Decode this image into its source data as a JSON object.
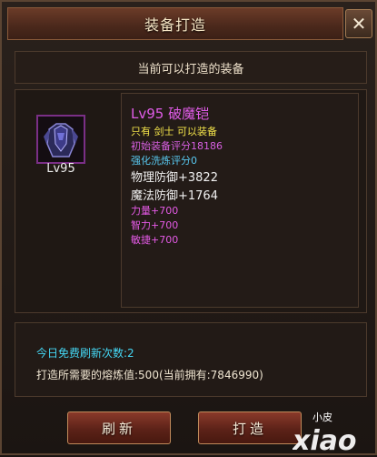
{
  "window": {
    "title": "装备打造",
    "close_icon": "close-x-icon",
    "subtitle": "当前可以打造的装备"
  },
  "item": {
    "icon": "armor-icon",
    "level_label": "Lv95",
    "name": "Lv95 破魔铠",
    "restriction": "只有 剑士 可以装备",
    "base_score": "初始装备评分18186",
    "refine_score": "强化洗炼评分0",
    "stats": [
      "物理防御+3822",
      "魔法防御+1764"
    ],
    "bonus_stats": [
      "力量+700",
      "智力+700",
      "敏捷+700"
    ]
  },
  "info": {
    "free_refresh": "今日免费刷新次数:2",
    "cost": "打造所需要的熔炼值:500(当前拥有:7846990)"
  },
  "buttons": {
    "refresh": "刷新",
    "forge": "打造"
  },
  "watermark": {
    "small": "小皮",
    "large": "xiao"
  },
  "colors": {
    "name": "#e05ce8",
    "restriction": "#f2e24a",
    "base_score": "#d65fe0",
    "refine_score": "#58c8f0",
    "stats": "#f0f0f0",
    "bonus": "#e45ae6",
    "free_refresh": "#45d8f5",
    "cost": "#f0e6d2"
  }
}
